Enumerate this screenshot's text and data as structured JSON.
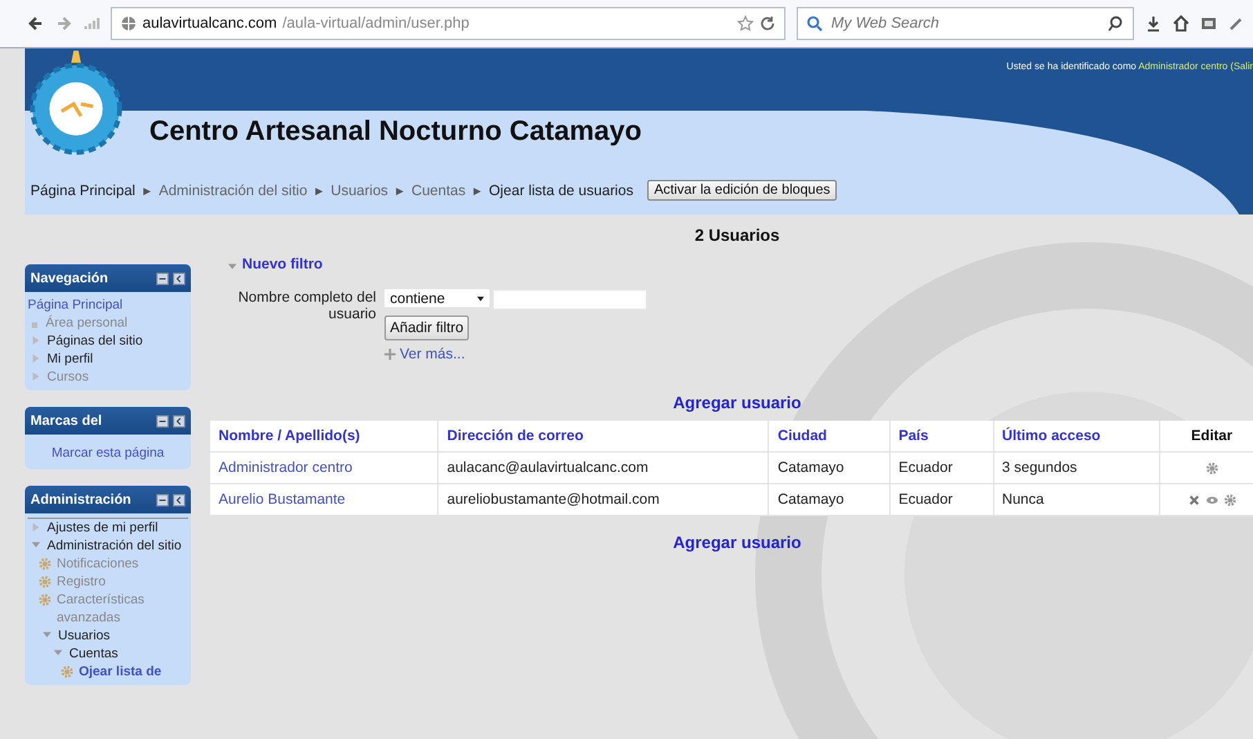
{
  "browser": {
    "url_host": "aulavirtualcanc.com",
    "url_path": "/aula-virtual/admin/user.php",
    "search_placeholder": "My Web Search"
  },
  "header": {
    "site_title": "Centro Artesanal Nocturno Catamayo",
    "login_text": "Usted se ha identificado como",
    "login_user": "Administrador centro",
    "login_tail": "(Salir"
  },
  "breadcrumb": [
    {
      "label": "Página Principal",
      "muted": false
    },
    {
      "label": "Administración del sitio",
      "muted": true
    },
    {
      "label": "Usuarios",
      "muted": true
    },
    {
      "label": "Cuentas",
      "muted": true
    },
    {
      "label": "Ojear lista de usuarios",
      "muted": false
    }
  ],
  "breadcrumb_separator": "►",
  "edit_blocks_button": "Activar la edición de bloques",
  "sidebar": {
    "blocks": [
      {
        "kind": "tree",
        "title": "Navegación",
        "items": [
          {
            "label": "Página Principal",
            "kind": "link"
          },
          {
            "label": "Área personal",
            "kind": "bullet"
          },
          {
            "label": "Páginas del sitio",
            "kind": "branch"
          },
          {
            "label": "Mi perfil",
            "kind": "branch"
          },
          {
            "label": "Cursos",
            "kind": "muted"
          }
        ]
      },
      {
        "kind": "action",
        "title": "Marcas del",
        "action": "Marcar esta página"
      },
      {
        "kind": "tree",
        "title": "Administración",
        "items": [
          {
            "label": "Ajustes de mi perfil",
            "kind": "branch"
          },
          {
            "label": "Administración del sitio",
            "kind": "open",
            "children": [
              {
                "label": "Notificaciones",
                "kind": "setting"
              },
              {
                "label": "Registro",
                "kind": "setting"
              },
              {
                "label": "Características avanzadas",
                "kind": "setting"
              },
              {
                "label": "Usuarios",
                "kind": "open",
                "children": [
                  {
                    "label": "Cuentas",
                    "kind": "open",
                    "children": [
                      {
                        "label": "Ojear lista de",
                        "kind": "current"
                      }
                    ]
                  }
                ]
              }
            ]
          }
        ]
      }
    ]
  },
  "main": {
    "title": "2 Usuarios",
    "filter_toggle": "Nuevo filtro",
    "filter_label": "Nombre completo del usuario",
    "filter_operator": "contiene",
    "add_filter_button": "Añadir filtro",
    "more_link": "Ver más...",
    "add_user_top": "Agregar usuario",
    "add_user_bottom": "Agregar usuario"
  },
  "table": {
    "columns": [
      {
        "label": "Nombre / Apellido(s)",
        "kind": "link"
      },
      {
        "label": "Dirección de correo",
        "kind": "link"
      },
      {
        "label": "Ciudad",
        "kind": "link"
      },
      {
        "label": "País",
        "kind": "link"
      },
      {
        "label": "Último acceso",
        "kind": "link"
      },
      {
        "label": "Editar",
        "kind": "plain"
      }
    ],
    "rows": [
      {
        "cells": [
          "Administrador centro",
          "aulacanc@aulavirtualcanc.com",
          "Catamayo",
          "Ecuador",
          "3 segundos"
        ],
        "actions": [
          {
            "kind": "settings"
          }
        ]
      },
      {
        "cells": [
          "Aurelio Bustamante",
          "aureliobustamante@hotmail.com",
          "Catamayo",
          "Ecuador",
          "Nunca"
        ],
        "actions": [
          {
            "kind": "delete"
          },
          {
            "kind": "view"
          },
          {
            "kind": "settings"
          }
        ]
      }
    ]
  }
}
